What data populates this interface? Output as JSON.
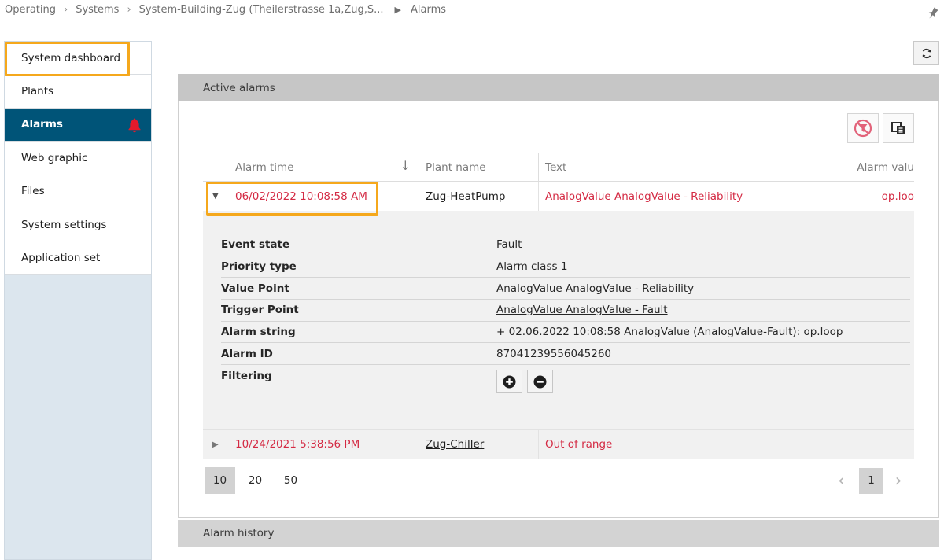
{
  "breadcrumb": {
    "items": [
      "Operating",
      "Systems",
      "System-Building-Zug (Theilerstrasse 1a,Zug,S...",
      "Alarms"
    ],
    "separator": ">"
  },
  "sidebar": {
    "items": [
      {
        "label": "System dashboard"
      },
      {
        "label": "Plants"
      },
      {
        "label": "Alarms",
        "active": true,
        "icon": "bell-icon"
      },
      {
        "label": "Web graphic"
      },
      {
        "label": "Files"
      },
      {
        "label": "System settings"
      },
      {
        "label": "Application set"
      }
    ]
  },
  "active_alarms": {
    "title": "Active alarms",
    "columns": [
      "Alarm time",
      "Plant name",
      "Text",
      "Alarm valu"
    ],
    "rows": [
      {
        "time": "06/02/2022 10:08:58 AM",
        "plant": "Zug-HeatPump",
        "text": "AnalogValue AnalogValue - Reliability",
        "value": "op.loo",
        "expanded": true
      },
      {
        "time": "10/24/2021 5:38:56 PM",
        "plant": "Zug-Chiller",
        "text": "Out of range",
        "value": "",
        "expanded": false
      }
    ],
    "details": [
      {
        "label": "Event state",
        "value": "Fault"
      },
      {
        "label": "Priority type",
        "value": "Alarm class 1"
      },
      {
        "label": "Value Point",
        "value": "AnalogValue AnalogValue - Reliability"
      },
      {
        "label": "Trigger Point",
        "value": "AnalogValue AnalogValue - Fault"
      },
      {
        "label": "Alarm string",
        "value": "+ 02.06.2022 10:08:58 AnalogValue (AnalogValue-Fault): op.loop"
      },
      {
        "label": "Alarm ID",
        "value": "87041239556045260"
      },
      {
        "label": "Filtering",
        "value": ""
      }
    ],
    "page_sizes": [
      "10",
      "20",
      "50"
    ],
    "selected_page_size": "10",
    "current_page": "1"
  },
  "alarm_history": {
    "title": "Alarm history"
  },
  "colors": {
    "accent": "#005478",
    "alarm_red": "#d42a43",
    "highlight": "#f5a81c",
    "panel_header": "#c6c6c6",
    "sidebar_bg": "#dce6ee"
  }
}
